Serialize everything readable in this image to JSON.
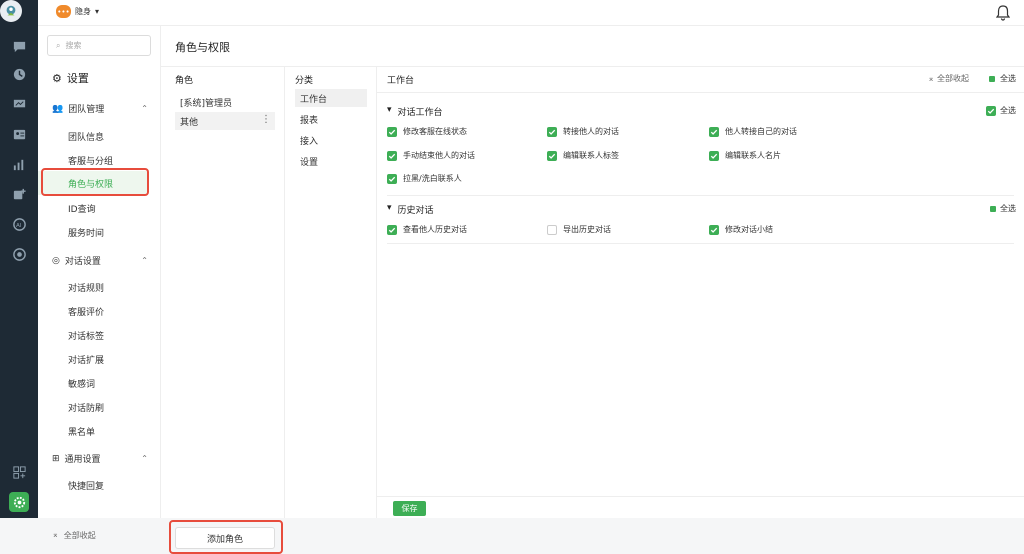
{
  "topbar": {
    "status_label": "隐身"
  },
  "sidebar": {
    "search_placeholder": "搜索",
    "title": "设置",
    "groups": [
      {
        "label": "团队管理",
        "items": [
          "团队信息",
          "客服与分组",
          "角色与权限",
          "ID查询",
          "服务时间"
        ]
      },
      {
        "label": "对话设置",
        "items": [
          "对话规则",
          "客服评价",
          "对话标签",
          "对话扩展",
          "敏感词",
          "对话防刷",
          "黑名单"
        ]
      },
      {
        "label": "通用设置",
        "items": [
          "快捷回复"
        ]
      }
    ],
    "collapse_all": "全部收起"
  },
  "main": {
    "page_title": "角色与权限",
    "roles_header": "角色",
    "roles": [
      "[系统]管理员",
      "其他"
    ],
    "add_role": "添加角色",
    "categories_header": "分类",
    "categories": [
      "工作台",
      "报表",
      "接入",
      "设置"
    ],
    "perm_header": "工作台",
    "collapse_all": "全部收起",
    "select_all": "全选",
    "sections": [
      {
        "title": "对话工作台",
        "select_all": "全选",
        "items": [
          {
            "label": "修改客服在线状态",
            "checked": true
          },
          {
            "label": "转接他人的对话",
            "checked": true
          },
          {
            "label": "他人转接自己的对话",
            "checked": true
          },
          {
            "label": "手动结束他人的对话",
            "checked": true
          },
          {
            "label": "编辑联系人标签",
            "checked": true
          },
          {
            "label": "编辑联系人名片",
            "checked": true
          },
          {
            "label": "拉黑/洗白联系人",
            "checked": true
          }
        ]
      },
      {
        "title": "历史对话",
        "select_all": "全选",
        "items": [
          {
            "label": "查看他人历史对话",
            "checked": true
          },
          {
            "label": "导出历史对话",
            "checked": false
          },
          {
            "label": "修改对话小结",
            "checked": true
          }
        ]
      }
    ],
    "save": "保存"
  },
  "colors": {
    "accent": "#3dae55",
    "rail": "#1e2a35",
    "highlight": "#e74c3c"
  }
}
